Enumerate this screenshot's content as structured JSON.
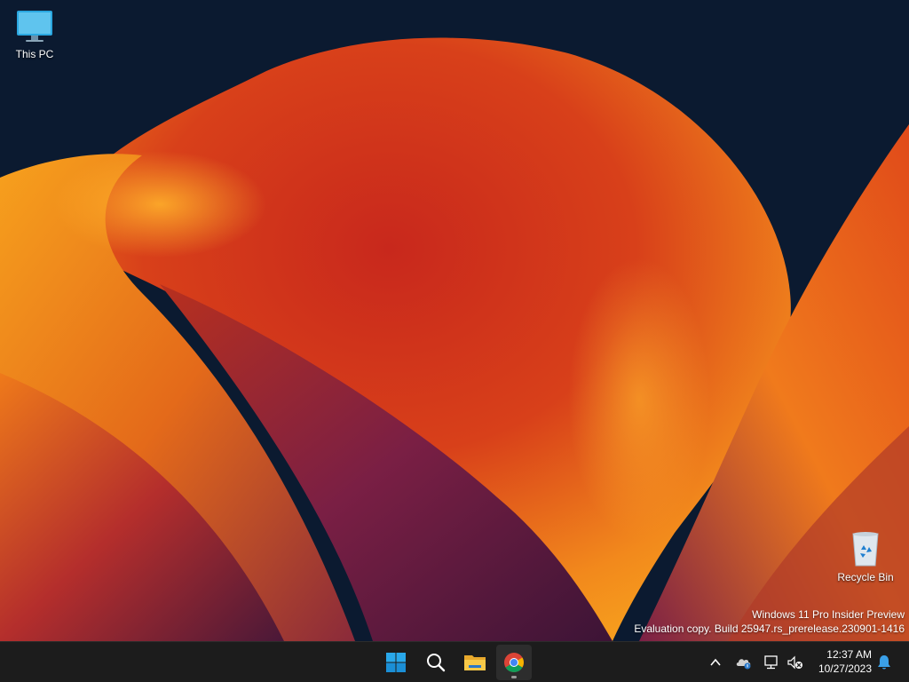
{
  "desktop": {
    "icons": [
      {
        "label": "This PC",
        "icon": "monitor-icon"
      },
      {
        "label": "Recycle Bin",
        "icon": "recycle-bin-icon"
      }
    ],
    "watermark": {
      "line1": "Windows 11 Pro Insider Preview",
      "line2": "Evaluation copy. Build 25947.rs_prerelease.230901-1416"
    }
  },
  "taskbar": {
    "apps": [
      {
        "name": "Start",
        "icon": "windows-logo-icon"
      },
      {
        "name": "Search",
        "icon": "search-icon"
      },
      {
        "name": "File Explorer",
        "icon": "folder-icon"
      },
      {
        "name": "Google Chrome",
        "icon": "chrome-icon",
        "active": true
      }
    ],
    "tray": {
      "icons": [
        "chevron-up-icon",
        "onedrive-icon",
        "network-icon",
        "volume-muted-icon",
        "bell-icon"
      ],
      "time": "12:37 AM",
      "date": "10/27/2023"
    }
  },
  "colors": {
    "taskbar_bg": "#1c1c1c",
    "desktop_bg": "#0b1a30",
    "accent_blue": "#0a8bd6",
    "wallpaper_orange": "#f08a1c",
    "wallpaper_red": "#c22a1c",
    "wallpaper_purple": "#6b1f4e"
  }
}
